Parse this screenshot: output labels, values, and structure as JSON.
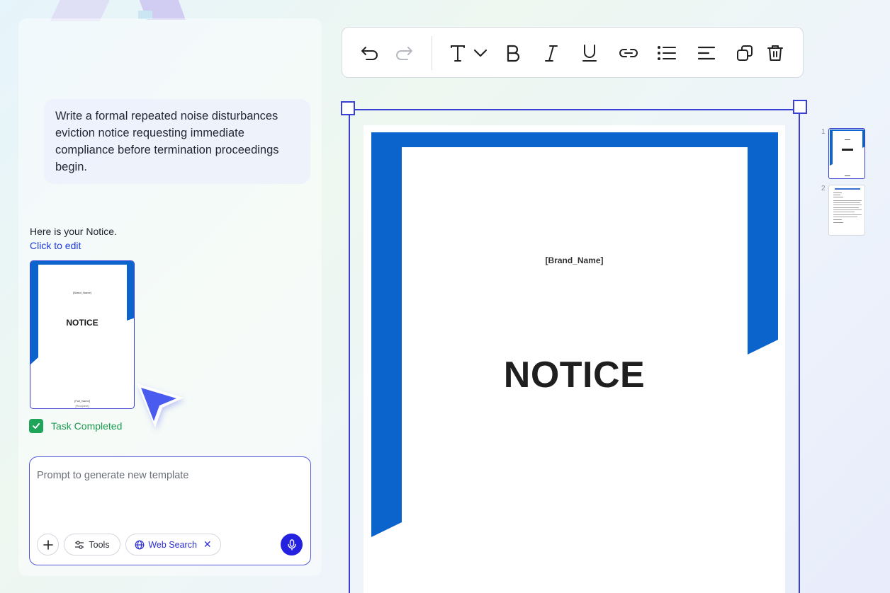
{
  "chat": {
    "user_prompt": "Write a formal repeated noise disturbances eviction notice requesting immediate compliance before termination proceedings begin.",
    "reply": "Here is your Notice.",
    "edit_link": "Click to edit",
    "task_status": "Task Completed"
  },
  "thumbnail": {
    "brand": "[Brand_Name]",
    "title": "NOTICE",
    "name": "[Full_Name]",
    "role": "[Recipient]"
  },
  "prompt_box": {
    "placeholder": "Prompt to generate new template",
    "tools_label": "Tools",
    "web_search_label": "Web Search"
  },
  "toolbar": {
    "icons": [
      "undo-icon",
      "redo-icon",
      "text-icon",
      "chevron-down-icon",
      "bold-icon",
      "italic-icon",
      "underline-icon",
      "link-icon",
      "list-icon",
      "align-left-icon",
      "duplicate-icon",
      "trash-icon"
    ]
  },
  "document": {
    "brand": "[Brand_Name]",
    "title": "NOTICE"
  },
  "pages": [
    {
      "number": "1"
    },
    {
      "number": "2"
    }
  ],
  "colors": {
    "accent": "#3a3fd6",
    "brand_blue": "#0a64cc",
    "success": "#1ea55a",
    "mic": "#2422e0"
  }
}
